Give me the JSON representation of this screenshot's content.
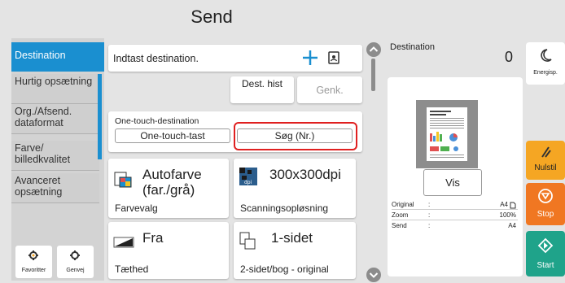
{
  "header": {
    "title": "Send"
  },
  "sidebar": {
    "items": [
      {
        "label": "Destination"
      },
      {
        "label": "Hurtig opsætning"
      },
      {
        "label": "Org./Afsend. dataformat"
      },
      {
        "label": "Farve/ billedkvalitet"
      },
      {
        "label": "Avanceret opsætning"
      }
    ],
    "shortcuts": [
      {
        "label": "Favoritter",
        "icon": "favorites-gear-icon"
      },
      {
        "label": "Genvej",
        "icon": "shortcut-gear-icon"
      }
    ]
  },
  "destination_input": {
    "placeholder": "Indtast destination.",
    "add_icon": "plus-icon",
    "book_icon": "address-book-icon"
  },
  "dest_hist": {
    "label": "Dest. hist"
  },
  "genk": {
    "label": "Genk."
  },
  "one_touch": {
    "label": "One-touch-destination",
    "key_button": "One-touch-tast",
    "search_button": "Søg (Nr.)"
  },
  "tiles": [
    {
      "value": "Autofarve (far./grå)",
      "caption": "Farvevalg",
      "icon": "auto-color-icon"
    },
    {
      "value": "300x300dpi",
      "caption": "Scanningsopløsning",
      "icon": "dpi-icon"
    },
    {
      "value": "Fra",
      "caption": "Tæthed",
      "icon": "density-icon"
    },
    {
      "value": "1-sidet",
      "caption": "2-sidet/bog - original",
      "icon": "duplex-icon"
    }
  ],
  "preview": {
    "label": "Destination",
    "count": "0",
    "view_button": "Vis",
    "info": [
      {
        "key": "Original",
        "sep": ":",
        "value": "A4"
      },
      {
        "key": "Zoom",
        "sep": ":",
        "value": "100%"
      },
      {
        "key": "Send",
        "sep": ":",
        "value": "A4"
      }
    ]
  },
  "right_buttons": {
    "energy": {
      "label": "Energisp.",
      "icon": "moon-icon"
    },
    "reset": {
      "label": "Nulstil",
      "icon": "reset-icon",
      "color": "#f5a623"
    },
    "stop": {
      "label": "Stop",
      "icon": "stop-icon",
      "color": "#f07722"
    },
    "start": {
      "label": "Start",
      "icon": "start-icon",
      "color": "#1fa38a"
    }
  },
  "colors": {
    "accent": "#1a8fd0",
    "highlight": "#e02020"
  }
}
